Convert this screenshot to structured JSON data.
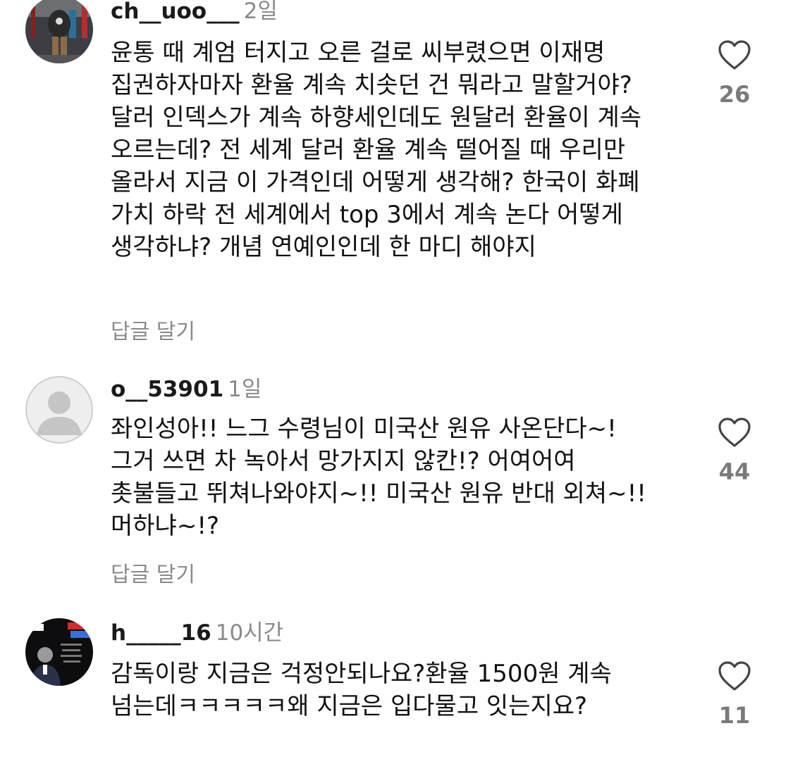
{
  "comments": [
    {
      "username": "ch__uoo___",
      "time": "2일",
      "text": "윤통 때 계엄 터지고 오른 걸로 씨부렸으면 이재명 집권하자마자 환율 계속 치솟던 건 뭐라고 말할거야? 달러 인덱스가 계속 하향세인데도 원달러 환율이 계속 오르는데? 전 세계 달러 환율 계속 떨어질 때 우리만 올라서 지금 이 가격인데 어떻게 생각해? 한국이 화폐 가치 하락 전 세계에서 top 3에서 계속 논다 어떻게 생각하냐? 개념 연예인인데 한 마디 해야지",
      "reply_label": "답글 달기",
      "likes": "26",
      "avatar_icon": "profile-photo-gym"
    },
    {
      "username": "o__53901",
      "time": "1일",
      "text": "좌인성아!! 느그 수령님이 미국산 원유 사온단다~! 그거 쓰면 차 녹아서 망가지지 않칸!? 어여어여 촛불들고 뛰쳐나와야지~!! 미국산 원유 반대 외쳐~!!머하냐~!?",
      "reply_label": "답글 달기",
      "likes": "44",
      "avatar_icon": "default-user-icon"
    },
    {
      "username": "h_____16",
      "time": "10시간",
      "text": "감독이랑 지금은 걱정안되나요?환율 1500원 계속 넘는데ㅋㅋㅋㅋㅋ왜 지금은 입다물고 잇는지요?",
      "reply_label": "",
      "likes": "11",
      "avatar_icon": "profile-photo-poster"
    }
  ],
  "colors": {
    "text": "#111111",
    "muted": "#8a8a8a",
    "like_count": "#7a7a7a"
  }
}
